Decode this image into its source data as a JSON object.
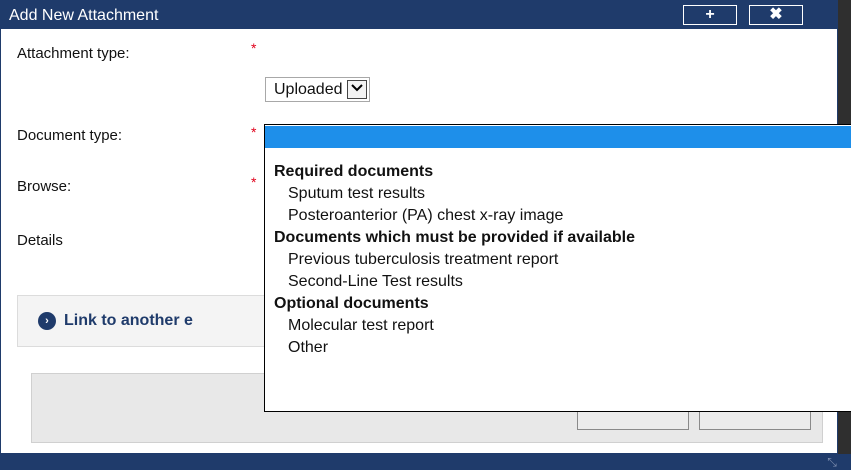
{
  "dialog": {
    "title": "Add New Attachment",
    "add_button": "+",
    "close_button": "✖"
  },
  "form": {
    "attachment_type_label": "Attachment type:",
    "attachment_type_value": "Uploaded",
    "document_type_label": "Document type:",
    "browse_label": "Browse:",
    "details_label": "Details",
    "required_marker": "*"
  },
  "link": {
    "text": "Link to another e",
    "icon": "chevron-circle-right-icon"
  },
  "dropdown": {
    "selected": "",
    "groups": [
      {
        "label": "Required documents",
        "options": [
          "Sputum test results",
          "Posteroanterior (PA) chest x-ray image"
        ]
      },
      {
        "label": "Documents which must be provided if available",
        "options": [
          "Previous tuberculosis treatment report",
          "Second-Line Test results"
        ]
      },
      {
        "label": "Optional documents",
        "options": [
          "Molecular test report",
          "Other"
        ]
      }
    ]
  },
  "colors": {
    "titlebar": "#1f3b6b",
    "selection": "#1e8fea",
    "required": "#e0001a"
  }
}
